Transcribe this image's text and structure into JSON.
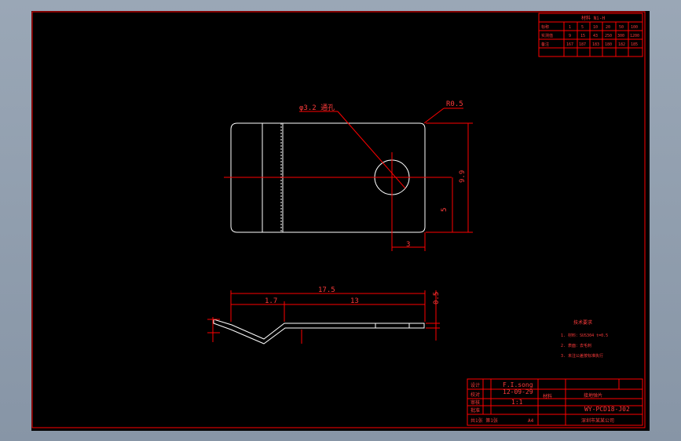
{
  "drawing": {
    "dimensions": {
      "hole_diameter": "φ3.2 通孔",
      "corner_radius": "R0.5",
      "height": "9.9",
      "hole_center_y": "5",
      "hole_center_x": "3",
      "total_length": "17.5",
      "bend_length": "1.7",
      "flat_length": "13",
      "thickness": "0.5"
    },
    "notes": {
      "title": "技术要求",
      "items": [
        "1. 材料：SUS304 t=0.5",
        "2. 表面：去毛刺",
        "3. 未注公差按标准执行"
      ]
    },
    "table": {
      "title": "材料 Ni-H",
      "rows": [
        [
          "标称",
          "1",
          "5",
          "10",
          "20",
          "50",
          "100"
        ],
        [
          "实测值",
          "9",
          "15",
          "43",
          "250",
          "300",
          "1200"
        ],
        [
          "备注",
          "167",
          "187",
          "183",
          "180",
          "182",
          "185"
        ]
      ]
    },
    "title_block": {
      "designer": "F.I.song",
      "date": "12-09-29",
      "scale": "1:1",
      "material_label": "材料",
      "part_name": "接地弹片",
      "drawing_no": "WY-PCD18-J02",
      "size": "A4",
      "company": "深圳市某某公司",
      "row_labels": [
        "设计",
        "校对",
        "审核",
        "批准"
      ],
      "footer_left": "共1张 第1张"
    }
  }
}
